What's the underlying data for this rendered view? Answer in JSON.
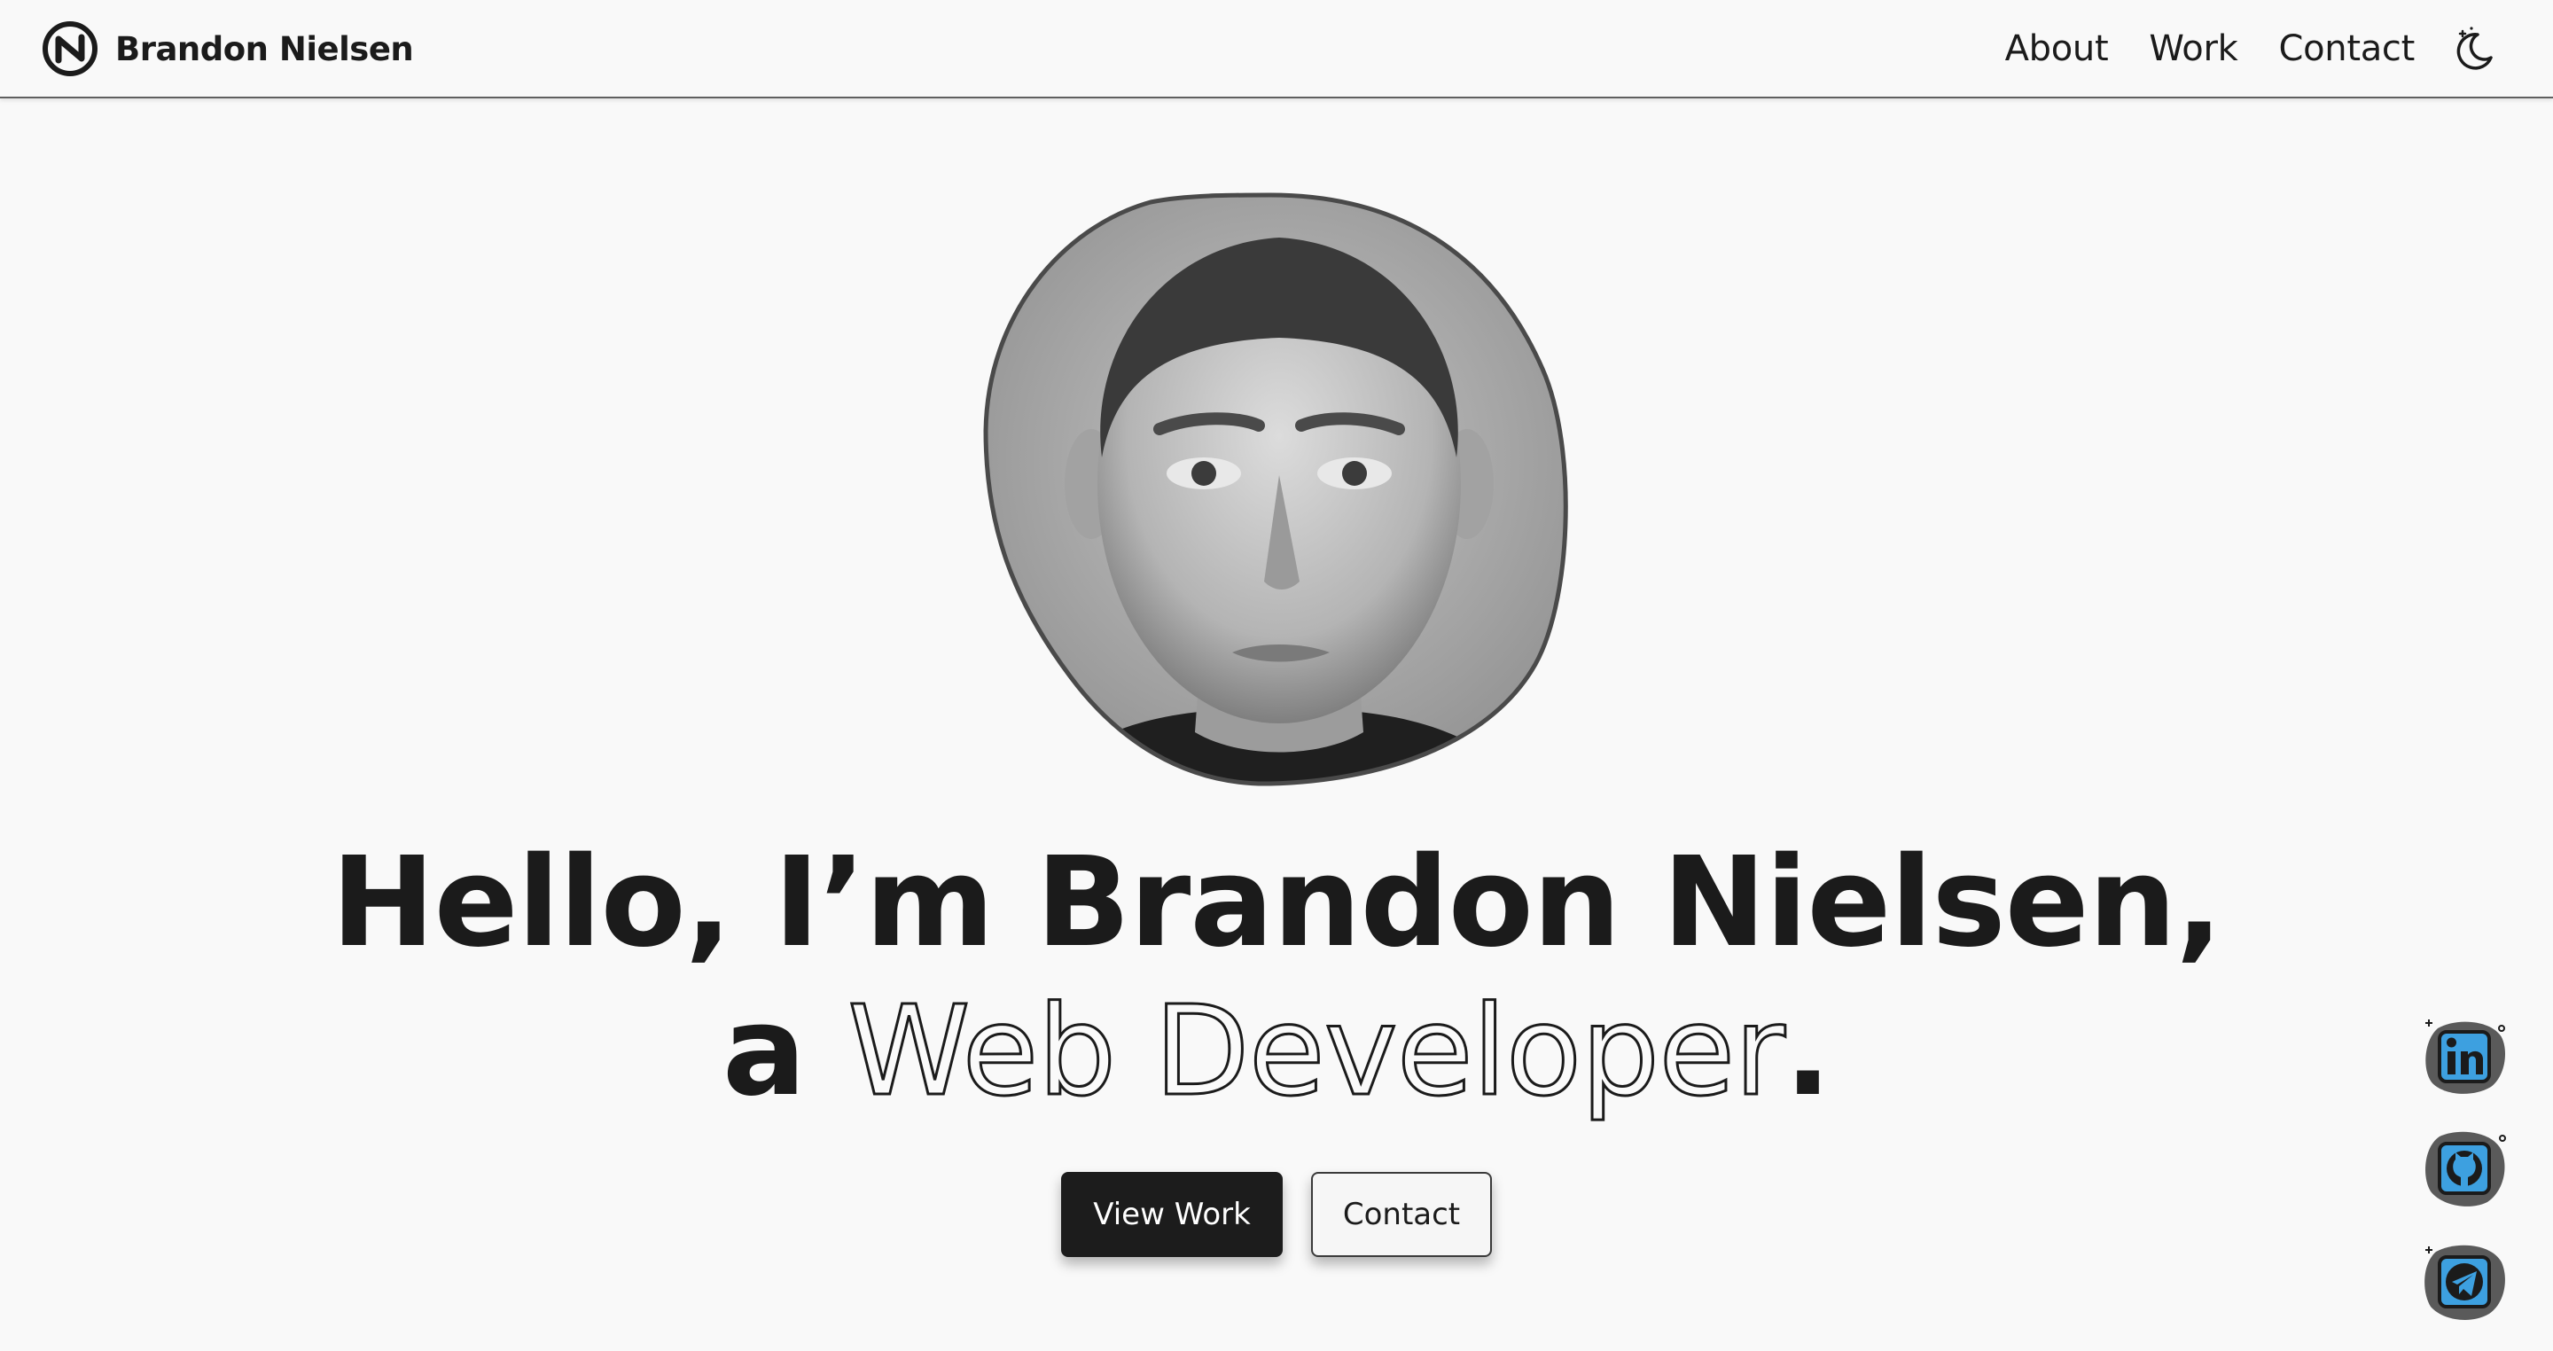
{
  "header": {
    "brand_name": "Brandon Nielsen",
    "nav": [
      {
        "label": "About"
      },
      {
        "label": "Work"
      },
      {
        "label": "Contact"
      }
    ],
    "theme_toggle_icon": "moon-icon"
  },
  "hero": {
    "portrait_alt": "Brandon Nielsen portrait",
    "title_line1": "Hello, I’m Brandon Nielsen,",
    "title_line2_prefix": "a",
    "title_line2_outline": "Web Developer",
    "title_line2_suffix": ".",
    "primary_button": "View Work",
    "secondary_button": "Contact"
  },
  "social": [
    {
      "icon": "linkedin-icon",
      "accent": "#3da0e0"
    },
    {
      "icon": "github-icon",
      "accent": "#3da0e0"
    },
    {
      "icon": "telegram-icon",
      "accent": "#3da0e0"
    }
  ],
  "colors": {
    "background": "#f9f9f9",
    "text": "#1b1b1b",
    "primary_button_bg": "#1c1c1c",
    "social_accent": "#3da0e0"
  }
}
